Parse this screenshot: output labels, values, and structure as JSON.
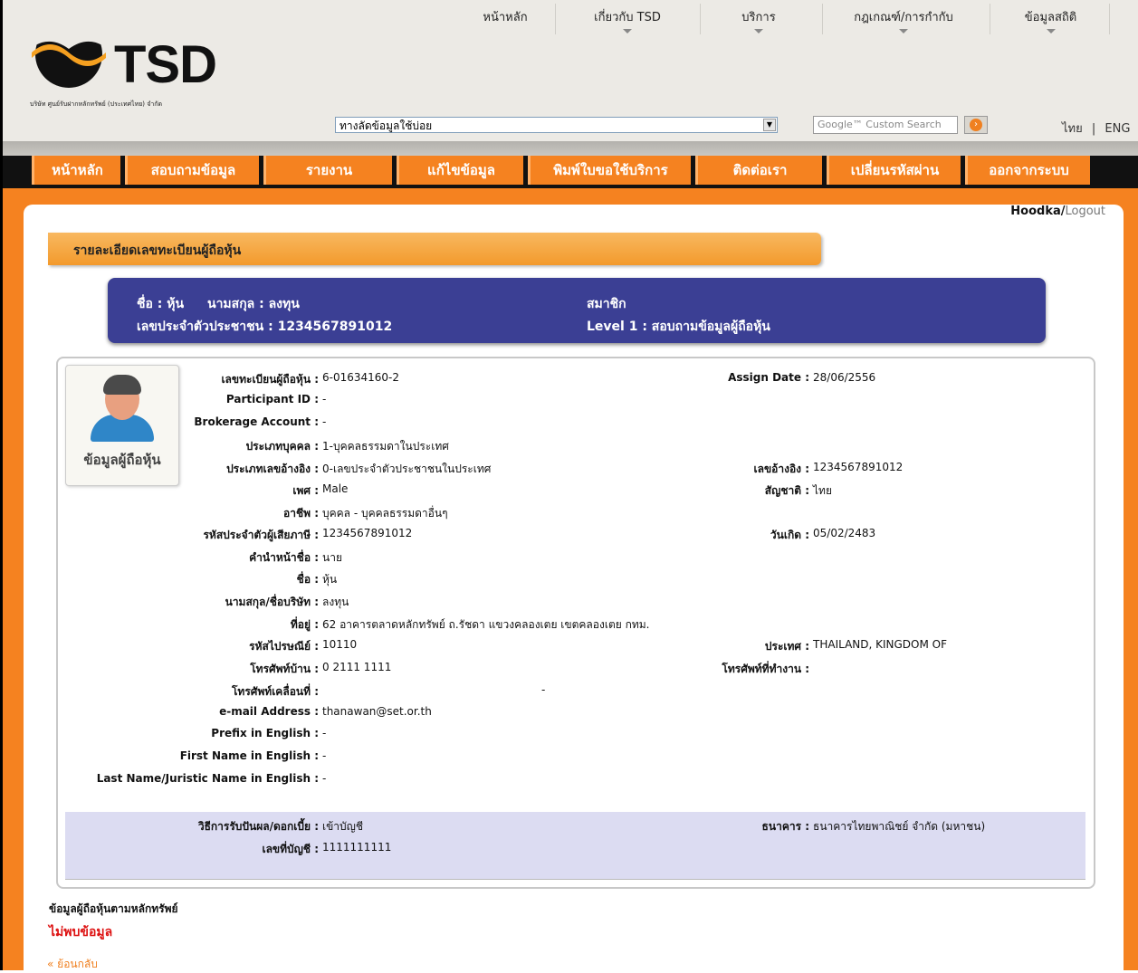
{
  "header": {
    "logo_text": "TSD",
    "company": "บริษัท ศูนย์รับฝากหลักทรัพย์ (ประเทศไทย) จำกัด",
    "topnav": [
      "หน้าหลัก",
      "เกี่ยวกับ TSD",
      "บริการ",
      "กฎเกณฑ์/การกำกับ",
      "ข้อมูลสถิติ"
    ],
    "shortcut_value": "ทางลัดข้อมูลใช้บ่อย",
    "search_placeholder": "Google™ Custom Search",
    "lang_th": "ไทย",
    "lang_sep": "|",
    "lang_en": "ENG"
  },
  "mainnav": [
    "หน้าหลัก",
    "สอบถามข้อมูล",
    "รายงาน",
    "แก้ไขข้อมูล",
    "พิมพ์ใบขอใช้บริการ",
    "ติดต่อเรา",
    "เปลี่ยนรหัสผ่าน",
    "ออกจากระบบ"
  ],
  "user": {
    "name": "Hoodka",
    "sep": "/",
    "logout": "Logout"
  },
  "page_title": "รายละเอียดเลขทะเบียนผู้ถือหุ้น",
  "infobar": {
    "first_name": "ชื่อ : หุ้น",
    "last_name": "นามสกุล : ลงทุน",
    "id_card": "เลขประจำตัวประชาชน : 1234567891012",
    "member": "สมาชิก",
    "level": "Level 1   :  สอบถามข้อมูลผู้ถือหุ้น"
  },
  "avatar_caption": "ข้อมูลผู้ถือหุ้น",
  "fields_left": [
    {
      "label": "เลขทะเบียนผู้ถือหุ้น :",
      "value": "6-01634160-2"
    },
    {
      "label": "Participant ID :",
      "value": "-"
    },
    {
      "label": "Brokerage Account :",
      "value": "-"
    },
    {
      "label": "ประเภทบุคคล :",
      "value": "1-บุคคลธรรมดาในประเทศ"
    },
    {
      "label": "ประเภทเลขอ้างอิง :",
      "value": "0-เลขประจำตัวประชาชนในประเทศ"
    },
    {
      "label": "เพศ :",
      "value": "Male"
    },
    {
      "label": "อาชีพ :",
      "value": "บุคคล - บุคคลธรรมดาอื่นๆ"
    },
    {
      "label": "รหัสประจำตัวผู้เสียภาษี :",
      "value": "1234567891012"
    },
    {
      "label": "คำนำหน้าชื่อ :",
      "value": "นาย"
    },
    {
      "label": "ชื่อ :",
      "value": "หุ้น"
    },
    {
      "label": "นามสกุล/ชื่อบริษัท :",
      "value": "ลงทุน"
    },
    {
      "label": "ที่อยู่ :",
      "value": "62 อาคารตลาดหลักทรัพย์ ถ.รัชดา แขวงคลองเตย เขตคลองเตย กทม."
    },
    {
      "label": "รหัสไปรษณีย์ :",
      "value": "10110"
    },
    {
      "label": "โทรศัพท์บ้าน :",
      "value": "0 2111 1111"
    },
    {
      "label": "โทรศัพท์เคลื่อนที่ :",
      "value": "-"
    },
    {
      "label": "e-mail Address :",
      "value": "thanawan@set.or.th"
    },
    {
      "label": "Prefix in English :",
      "value": "-"
    },
    {
      "label": "First Name in English :",
      "value": "-"
    },
    {
      "label": "Last Name/Juristic Name in English :",
      "value": "-"
    }
  ],
  "fields_right": [
    {
      "label": "Assign Date :",
      "value": "28/06/2556"
    },
    {
      "label": "เลขอ้างอิง :",
      "value": "1234567891012"
    },
    {
      "label": "สัญชาติ :",
      "value": "ไทย"
    },
    {
      "label": "วันเกิด :",
      "value": "05/02/2483"
    },
    {
      "label": "ประเทศ :",
      "value": "THAILAND, KINGDOM OF"
    },
    {
      "label": "โทรศัพท์ที่ทำงาน :",
      "value": ""
    }
  ],
  "bank": {
    "method_label": "วิธีการรับปันผล/ดอกเบี้ย :",
    "method_value": "เข้าบัญชี",
    "account_label": "เลขที่บัญชี :",
    "account_value": "1111111111",
    "bank_label": "ธนาคาร :",
    "bank_value": "ธนาคารไทยพาณิชย์ จำกัด (มหาชน)"
  },
  "securities_title": "ข้อมูลผู้ถือหุ้นตามหลักทรัพย์",
  "not_found": "ไม่พบข้อมูล",
  "back_link": "ย้อนกลับ",
  "colors": {
    "orange": "#f58220",
    "navy": "#3b3f94",
    "red": "#dd1111"
  }
}
